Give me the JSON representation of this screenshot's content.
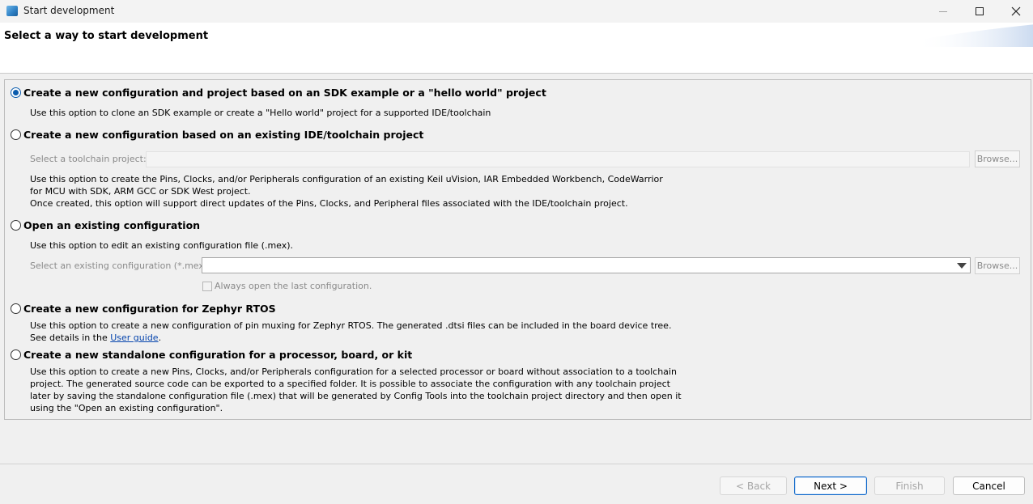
{
  "window": {
    "title": "Start development",
    "icon": "app-window-icon"
  },
  "header": {
    "title": "Select a way to start development"
  },
  "options": [
    {
      "label": "Create a new configuration and project based on an SDK example or a \"hello world\" project",
      "selected": true,
      "description": [
        "Use this option to clone an SDK example or create a \"Hello world\" project for a supported IDE/toolchain"
      ]
    },
    {
      "label": "Create a new configuration based on an existing IDE/toolchain project",
      "selected": false,
      "field_label": "Select a toolchain project:",
      "field_value": "",
      "browse_label": "Browse...",
      "description": [
        "Use this option to create the Pins, Clocks, and/or Peripherals configuration of an existing Keil uVision, IAR Embedded Workbench, CodeWarrior",
        "for MCU with SDK, ARM GCC or SDK West project.",
        "Once created, this option will support direct updates of the Pins, Clocks, and Peripheral files associated with the IDE/toolchain project."
      ]
    },
    {
      "label": "Open an existing configuration",
      "selected": false,
      "description": [
        "Use this option to edit an existing configuration file (.mex)."
      ],
      "field_label": "Select an existing configuration (*.mex)",
      "field_value": "",
      "browse_label": "Browse...",
      "checkbox_label": "Always open the last configuration.",
      "checkbox_checked": false
    },
    {
      "label": "Create a new configuration for Zephyr RTOS",
      "selected": false,
      "description": [
        "Use this option to create a new configuration of pin muxing for Zephyr RTOS. The generated .dtsi files can be included in the board device tree."
      ],
      "details_prefix": "See details in the ",
      "link_label": "User guide",
      "details_suffix": "."
    },
    {
      "label": "Create a new standalone configuration for a processor, board, or kit",
      "selected": false,
      "description": [
        "Use this option to create a new Pins, Clocks, and/or Peripherals configuration for a selected processor or board without association to a toolchain",
        "project. The generated source code can be exported to a specified folder. It is possible to associate the configuration with any toolchain project",
        "later by saving the standalone configuration file (.mex) that will be generated by Config Tools into the toolchain project directory and then open it",
        "using the \"Open an existing configuration\"."
      ]
    }
  ],
  "footer": {
    "back_label": "< Back",
    "next_label": "Next >",
    "finish_label": "Finish",
    "cancel_label": "Cancel"
  },
  "colors": {
    "accent": "#0b5cad",
    "link": "#0645ad",
    "disabled_text": "#8a8a8a"
  }
}
